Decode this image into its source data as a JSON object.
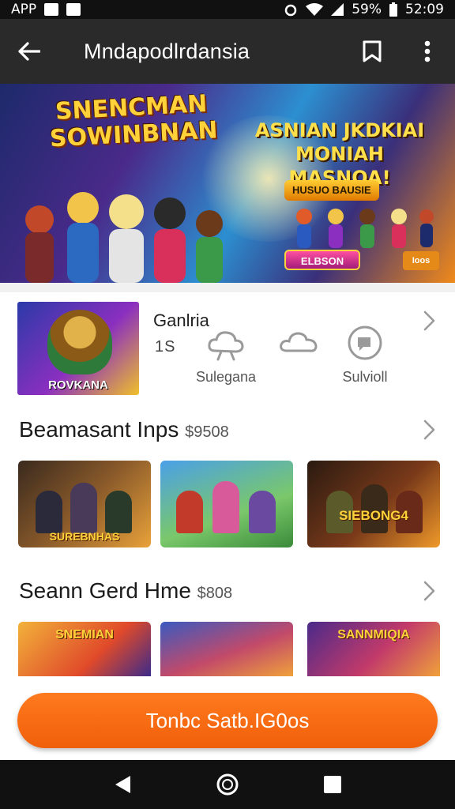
{
  "status_bar": {
    "app_label": "APP",
    "battery": "59%",
    "time": "52:09"
  },
  "app_bar": {
    "title": "Mndapodlrdansia"
  },
  "banner": {
    "logo_line1": "SNENCMAN",
    "logo_line2": "SOWINBNAN",
    "headline_line1": "ASNIAN JKDKIAI",
    "headline_line2": "MONIAH MASNOA!",
    "badge": "HUSUO BAUSIE",
    "button": "ELBSON",
    "tag": "Ioos"
  },
  "game": {
    "card_caption": "ROVKANA",
    "name": "Ganlria",
    "sub": "1S",
    "chips": [
      {
        "label": "Sulegana",
        "icon": "cloud-gear-icon"
      },
      {
        "label": "",
        "icon": "cloud-icon"
      },
      {
        "label": "Sulvioll",
        "icon": "shield-chat-icon"
      }
    ]
  },
  "sections": [
    {
      "title": "Beamasant Inps",
      "price": "$9508",
      "thumbs": [
        {
          "label": "SUREBNHAS"
        },
        {
          "label": ""
        },
        {
          "label": "SIEBONG4"
        }
      ]
    },
    {
      "title": "Seann Gerd Hme",
      "price": "$808",
      "thumbs": [
        {
          "label": "SNEMIAN"
        },
        {
          "label": ""
        },
        {
          "label": "SANNMIQIA"
        }
      ]
    }
  ],
  "cta": {
    "label": "Tonbc Satb.IG0os"
  },
  "colors": {
    "accent": "#f26a12",
    "app_bar": "#2a2a2a",
    "nav_bar": "#111111"
  }
}
